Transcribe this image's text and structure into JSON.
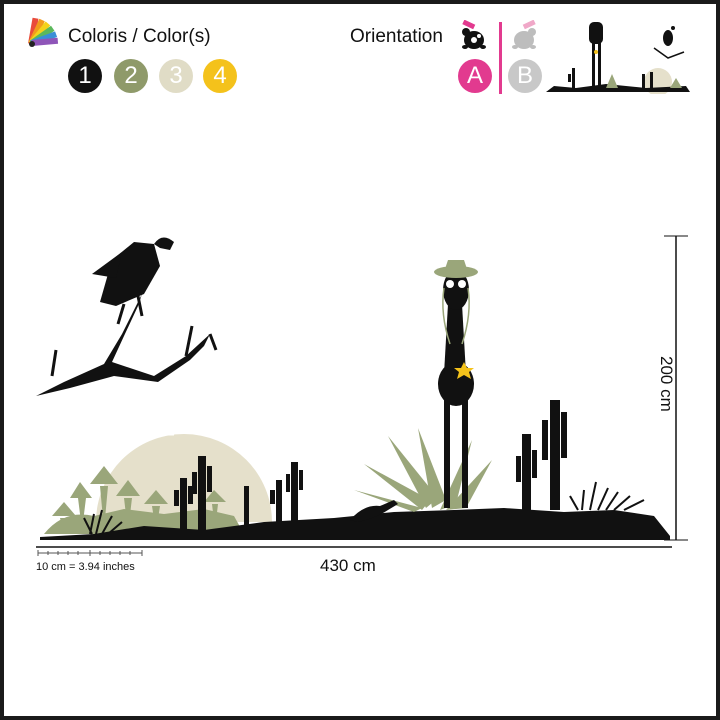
{
  "header": {
    "colors_title": "Coloris / Color(s)",
    "orientation_title": "Orientation"
  },
  "swatches": [
    {
      "label": "1",
      "color": "#111111"
    },
    {
      "label": "2",
      "color": "#8f9a6a"
    },
    {
      "label": "3",
      "color": "#e0dcc6"
    },
    {
      "label": "4",
      "color": "#f4c21b"
    }
  ],
  "orientation": {
    "options": [
      {
        "label": "A",
        "color": "#e23a8f"
      },
      {
        "label": "B",
        "color": "#c8c8c8"
      }
    ]
  },
  "dimensions": {
    "width": "430 cm",
    "height": "200 cm",
    "scale": "10 cm = 3.94 inches"
  },
  "icons": {
    "palette": "color-palette-icon",
    "orientation_a": "turtle-icon",
    "orientation_b": "turtle-icon",
    "preview": "scene-thumbnail"
  },
  "colors": {
    "silhouette": "#111111",
    "foliage": "#9aa67a",
    "sun": "#e5e0cb",
    "sheriff_star": "#f4c21b",
    "accent": "#e23a8f"
  }
}
